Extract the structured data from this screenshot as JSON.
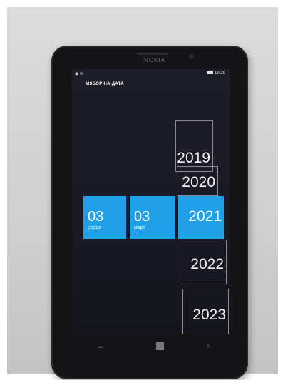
{
  "device": {
    "brand": "NOKIA"
  },
  "status_bar": {
    "left_icons": "◉ ✉",
    "time": "19:29"
  },
  "screen_title": "ИЗБОР НА ДАТА",
  "date_picker": {
    "day": {
      "value": "03",
      "label": "среда"
    },
    "month": {
      "value": "03",
      "label": "март"
    },
    "years": [
      "2019",
      "2020",
      "2021",
      "2022",
      "2023"
    ],
    "selected_year": "2021",
    "accent_color": "#1fa0e8"
  },
  "app_bar": {
    "confirm_icon": "check-circle-icon",
    "cancel_icon": "close-circle-icon",
    "more_icon": "ellipsis-icon"
  },
  "hardware_keys": {
    "back": "back-arrow-icon",
    "start": "windows-logo-icon",
    "search": "search-icon"
  }
}
